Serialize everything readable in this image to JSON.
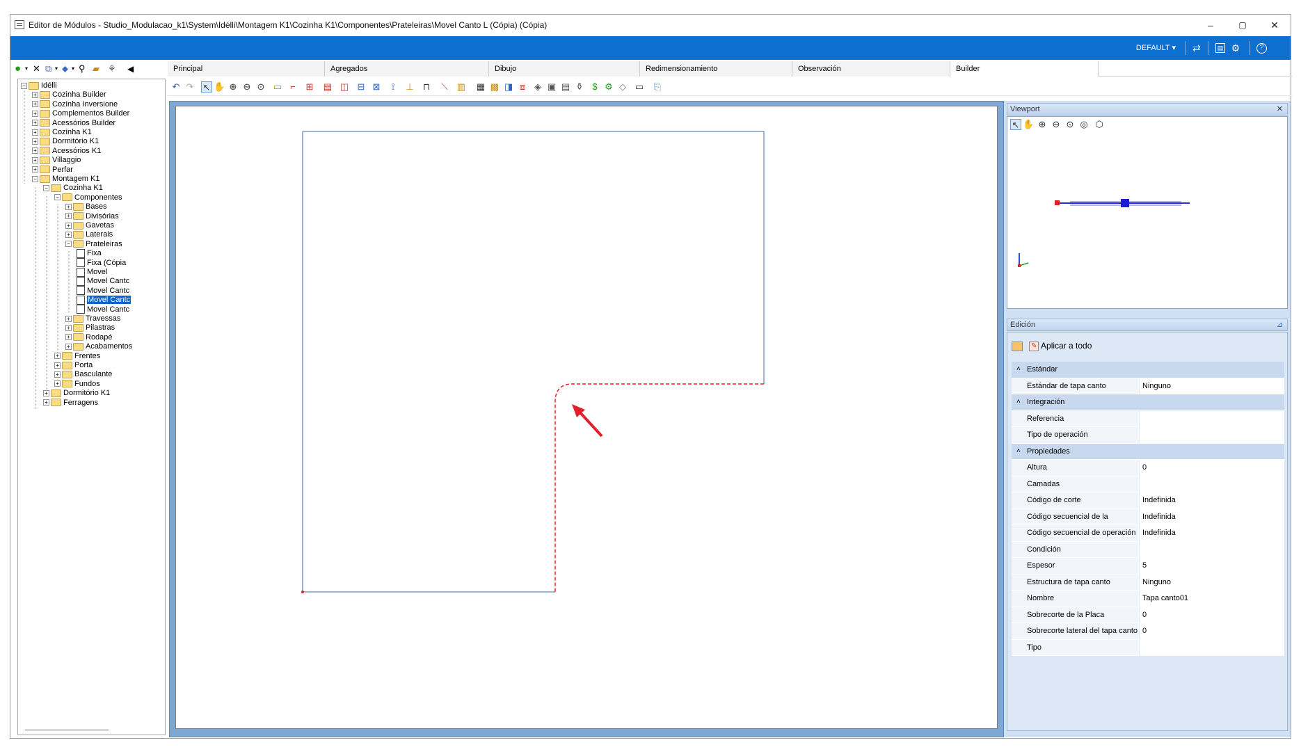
{
  "window": {
    "title": "Editor de Módulos - Studio_Modulacao_k1\\System\\Idélli\\Montagem K1\\Cozinha K1\\Componentes\\Prateleiras\\Movel Canto L (Cópia) (Cópia)",
    "minimize": "–",
    "maximize": "▢",
    "close": "✕"
  },
  "topbar": {
    "profile": "DEFAULT ▾",
    "help": "?"
  },
  "tabs": [
    "Principal",
    "Agregados",
    "Dibujo",
    "Redimensionamiento",
    "Observación",
    "Builder"
  ],
  "tree": [
    {
      "label": "Idélli",
      "level": 0,
      "type": "folder",
      "expanded": true
    },
    {
      "label": "Cozinha Builder",
      "level": 1,
      "type": "folder"
    },
    {
      "label": "Cozinha Inversione",
      "level": 1,
      "type": "folder"
    },
    {
      "label": "Complementos Builder",
      "level": 1,
      "type": "folder"
    },
    {
      "label": "Acessórios Builder",
      "level": 1,
      "type": "folder"
    },
    {
      "label": "Cozinha K1",
      "level": 1,
      "type": "folder"
    },
    {
      "label": "Dormitório K1",
      "level": 1,
      "type": "folder"
    },
    {
      "label": "Acessórios K1",
      "level": 1,
      "type": "folder"
    },
    {
      "label": "Villaggio",
      "level": 1,
      "type": "folder"
    },
    {
      "label": "Perfar",
      "level": 1,
      "type": "folder"
    },
    {
      "label": "Montagem K1",
      "level": 1,
      "type": "folder",
      "expanded": true
    },
    {
      "label": "Cozinha K1",
      "level": 2,
      "type": "folder",
      "expanded": true
    },
    {
      "label": "Componentes",
      "level": 3,
      "type": "folder",
      "expanded": true
    },
    {
      "label": "Bases",
      "level": 4,
      "type": "folder"
    },
    {
      "label": "Divisórias",
      "level": 4,
      "type": "folder"
    },
    {
      "label": "Gavetas",
      "level": 4,
      "type": "folder"
    },
    {
      "label": "Laterais",
      "level": 4,
      "type": "folder"
    },
    {
      "label": "Prateleiras",
      "level": 4,
      "type": "folder",
      "expanded": true
    },
    {
      "label": "Fixa",
      "level": 5,
      "type": "doc"
    },
    {
      "label": "Fixa (Cópia",
      "level": 5,
      "type": "doc"
    },
    {
      "label": "Movel",
      "level": 5,
      "type": "doc"
    },
    {
      "label": "Movel Cantc",
      "level": 5,
      "type": "doc"
    },
    {
      "label": "Movel Cantc",
      "level": 5,
      "type": "doc"
    },
    {
      "label": "Movel Cantc",
      "level": 5,
      "type": "doc",
      "selected": true
    },
    {
      "label": "Movel Cantc",
      "level": 5,
      "type": "doc"
    },
    {
      "label": "Travessas",
      "level": 4,
      "type": "folder"
    },
    {
      "label": "Pilastras",
      "level": 4,
      "type": "folder"
    },
    {
      "label": "Rodapé",
      "level": 4,
      "type": "folder"
    },
    {
      "label": "Acabamentos",
      "level": 4,
      "type": "folder"
    },
    {
      "label": "Frentes",
      "level": 3,
      "type": "folder"
    },
    {
      "label": "Porta",
      "level": 3,
      "type": "folder"
    },
    {
      "label": "Basculante",
      "level": 3,
      "type": "folder"
    },
    {
      "label": "Fundos",
      "level": 3,
      "type": "folder"
    },
    {
      "label": "Dormitório K1",
      "level": 2,
      "type": "folder"
    },
    {
      "label": "Ferragens",
      "level": 2,
      "type": "folder"
    }
  ],
  "viewport": {
    "title": "Viewport",
    "close": "✕"
  },
  "edicion": {
    "title": "Edición",
    "apply_label": "Aplicar a todo",
    "categories": [
      {
        "name": "Estándar",
        "rows": [
          {
            "k": "Estándar de tapa canto",
            "v": "Ninguno"
          }
        ]
      },
      {
        "name": "Integración",
        "rows": [
          {
            "k": "Referencia",
            "v": ""
          },
          {
            "k": "Tipo de operación",
            "v": ""
          }
        ]
      },
      {
        "name": "Propiedades",
        "rows": [
          {
            "k": "Altura",
            "v": "0"
          },
          {
            "k": "Camadas",
            "v": ""
          },
          {
            "k": "Código de corte",
            "v": "Indefinida"
          },
          {
            "k": "Código secuencial de la máquina",
            "v": "Indefinida"
          },
          {
            "k": "Código secuencial de operación",
            "v": "Indefinida"
          },
          {
            "k": "Condición",
            "v": ""
          },
          {
            "k": "Espesor",
            "v": "5"
          },
          {
            "k": "Estructura de tapa canto",
            "v": "Ninguno"
          },
          {
            "k": "Nombre",
            "v": "Tapa canto01"
          },
          {
            "k": "Sobrecorte de la Placa",
            "v": "0"
          },
          {
            "k": "Sobrecorte lateral del tapa canto",
            "v": "0"
          },
          {
            "k": "Tipo",
            "v": ""
          }
        ]
      }
    ]
  },
  "colors": {
    "accent": "#0d6fd0",
    "edge_highlight": "#e0202a",
    "outline": "#3c6ea8"
  }
}
